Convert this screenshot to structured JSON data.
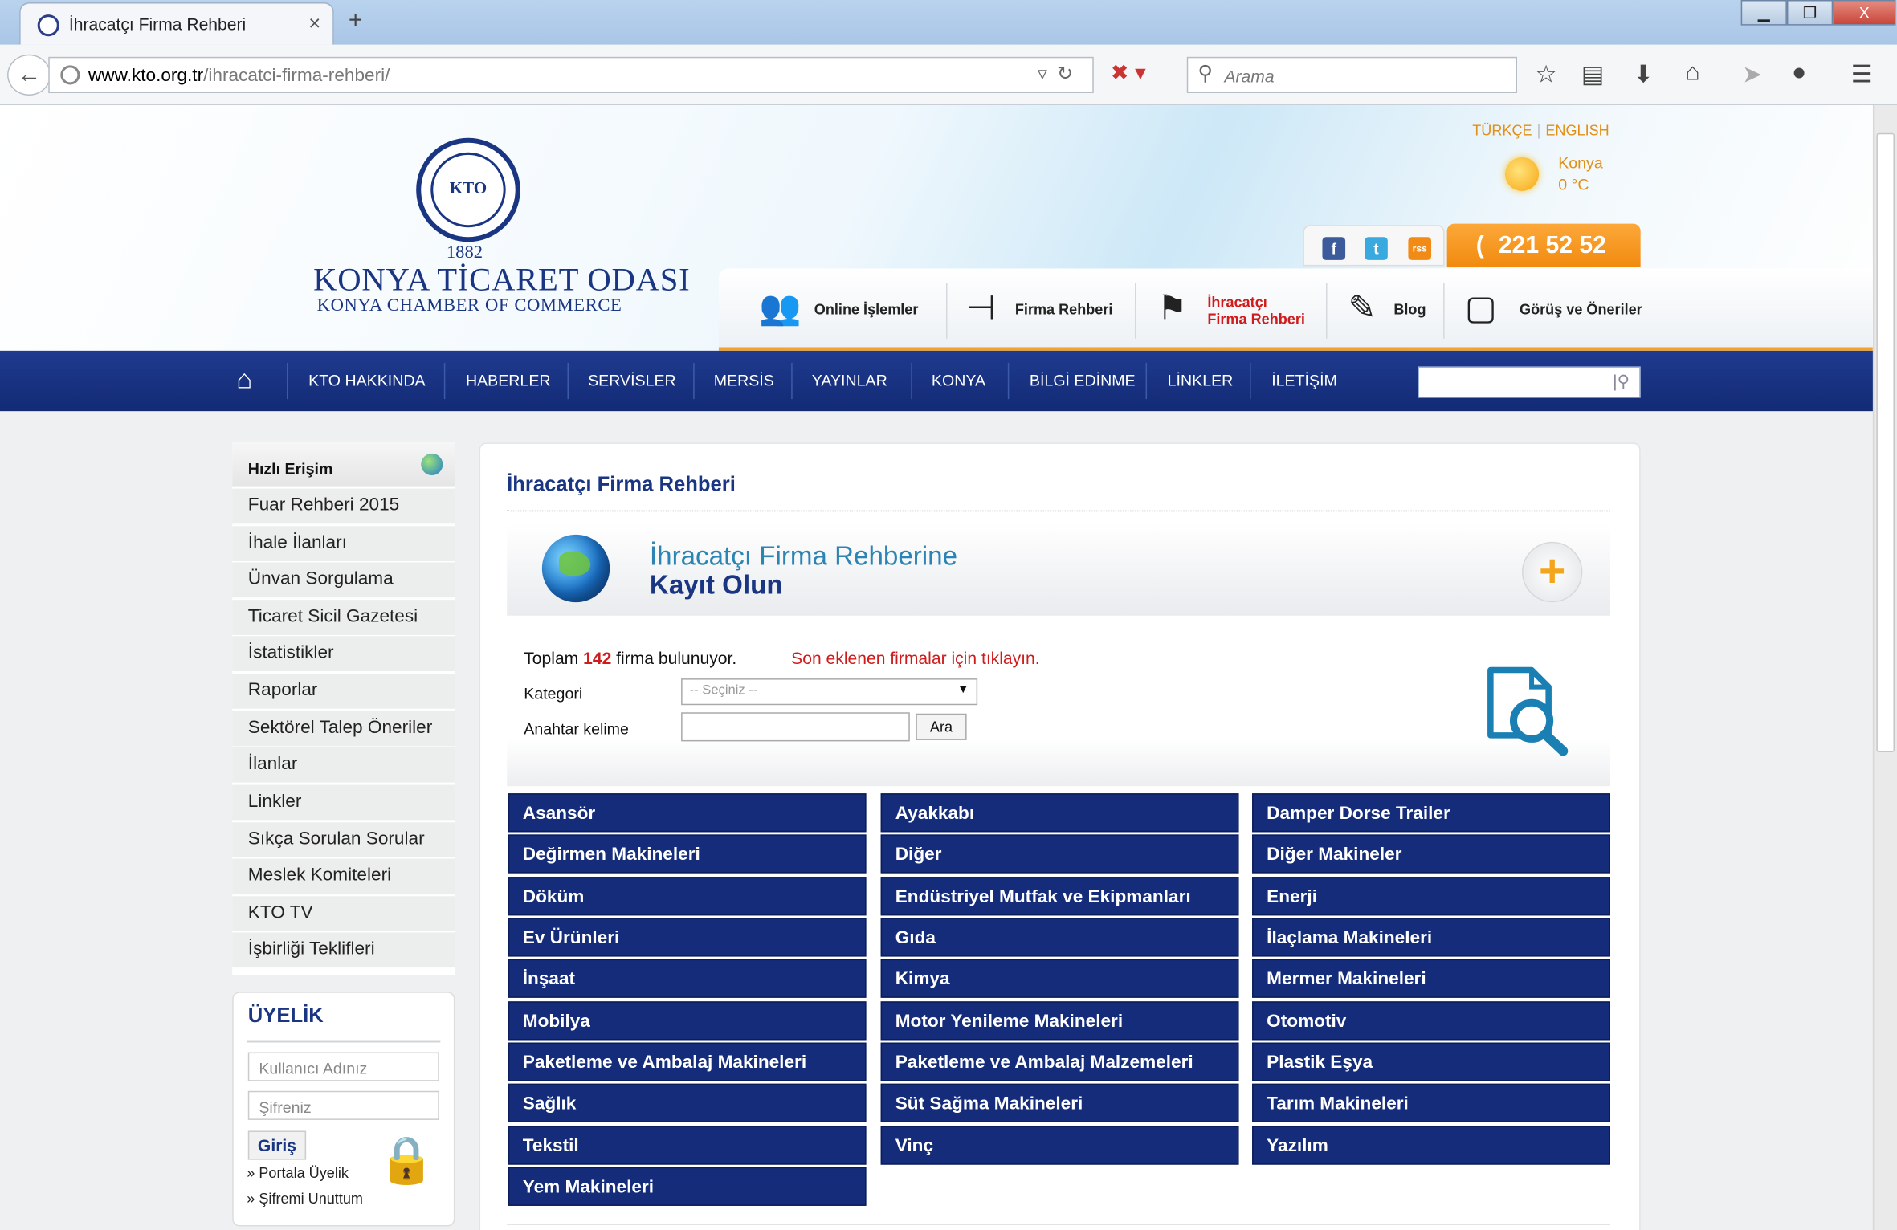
{
  "browser": {
    "tab_title": "İhracatçı Firma Rehberi",
    "tab_close": "×",
    "new_tab": "+",
    "url_domain": "www.kto.org.tr",
    "url_path": "/ihracatci-firma-rehberi/",
    "search_placeholder": "Arama",
    "window_min": "▁",
    "window_max": "❐",
    "window_close": "X"
  },
  "header": {
    "logo_year": "1882",
    "logo_name_tr": "KONYA TİCARET ODASI",
    "logo_name_en": "KONYA CHAMBER OF COMMERCE",
    "logo_mark": "KTO",
    "lang_tr": "TÜRKÇE",
    "lang_sep": "|",
    "lang_en": "ENGLISH",
    "weather_city": "Konya",
    "weather_temp": "0 °C",
    "phone": "221 52 52",
    "phone_icon": "(",
    "social": [
      "f",
      "t",
      "rss"
    ]
  },
  "quick_links": [
    {
      "label": "Online İşlemler",
      "icon": "people-icon"
    },
    {
      "label": "Firma Rehberi",
      "icon": "signpost-icon"
    },
    {
      "label1": "İhracatçı",
      "label2": "Firma Rehberi",
      "icon": "flag-icon"
    },
    {
      "label": "Blog",
      "icon": "edit-icon"
    },
    {
      "label": "Görüş ve Öneriler",
      "icon": "comment-icon"
    }
  ],
  "nav": {
    "items": [
      "KTO HAKKINDA",
      "HABERLER",
      "SERVİSLER",
      "MERSİS",
      "YAYINLAR",
      "KONYA",
      "BİLGİ EDİNME",
      "LİNKLER",
      "İLETİŞİM"
    ]
  },
  "sidebar": {
    "title": "Hızlı Erişim",
    "items": [
      "Fuar Rehberi 2015",
      "İhale İlanları",
      "Ünvan Sorgulama",
      "Ticaret Sicil Gazetesi",
      "İstatistikler",
      "Raporlar",
      "Sektörel Talep Öneriler",
      "İlanlar",
      "Linkler",
      "Sıkça Sorulan Sorular",
      "Meslek Komiteleri",
      "KTO TV",
      "İşbirliği Teklifleri"
    ]
  },
  "membership": {
    "title": "ÜYELİK",
    "username_placeholder": "Kullanıcı Adınız",
    "password_placeholder": "Şifreniz",
    "login": "Giriş",
    "portal": "» Portala Üyelik",
    "forgot": "» Şifremi Unuttum"
  },
  "main": {
    "title": "İhracatçı Firma Rehberi",
    "banner_line1": "İhracatçı Firma Rehberine",
    "banner_line2": "Kayıt Olun",
    "plus": "+",
    "total_prefix": "Toplam",
    "total_count": "142",
    "total_suffix": "firma bulunuyor.",
    "latest_link": "Son eklenen firmalar için tıklayın.",
    "category_label": "Kategori",
    "category_selected": "-- Seçiniz --",
    "keyword_label": "Anahtar kelime",
    "search_button": "Ara"
  },
  "categories": [
    [
      "Asansör",
      "Ayakkabı",
      "Damper Dorse Trailer"
    ],
    [
      "Değirmen Makineleri",
      "Diğer",
      "Diğer Makineler"
    ],
    [
      "Döküm",
      "Endüstriyel Mutfak ve Ekipmanları",
      "Enerji"
    ],
    [
      "Ev Ürünleri",
      "Gıda",
      "İlaçlama Makineleri"
    ],
    [
      "İnşaat",
      "Kimya",
      "Mermer Makineleri"
    ],
    [
      "Mobilya",
      "Motor Yenileme Makineleri",
      "Otomotiv"
    ],
    [
      "Paketleme ve Ambalaj Makineleri",
      "Paketleme ve Ambalaj Malzemeleri",
      "Plastik Eşya"
    ],
    [
      "Sağlık",
      "Süt Sağma Makineleri",
      "Tarım Makineleri"
    ],
    [
      "Tekstil",
      "Vinç",
      "Yazılım"
    ],
    [
      "Yem Makineleri"
    ]
  ]
}
